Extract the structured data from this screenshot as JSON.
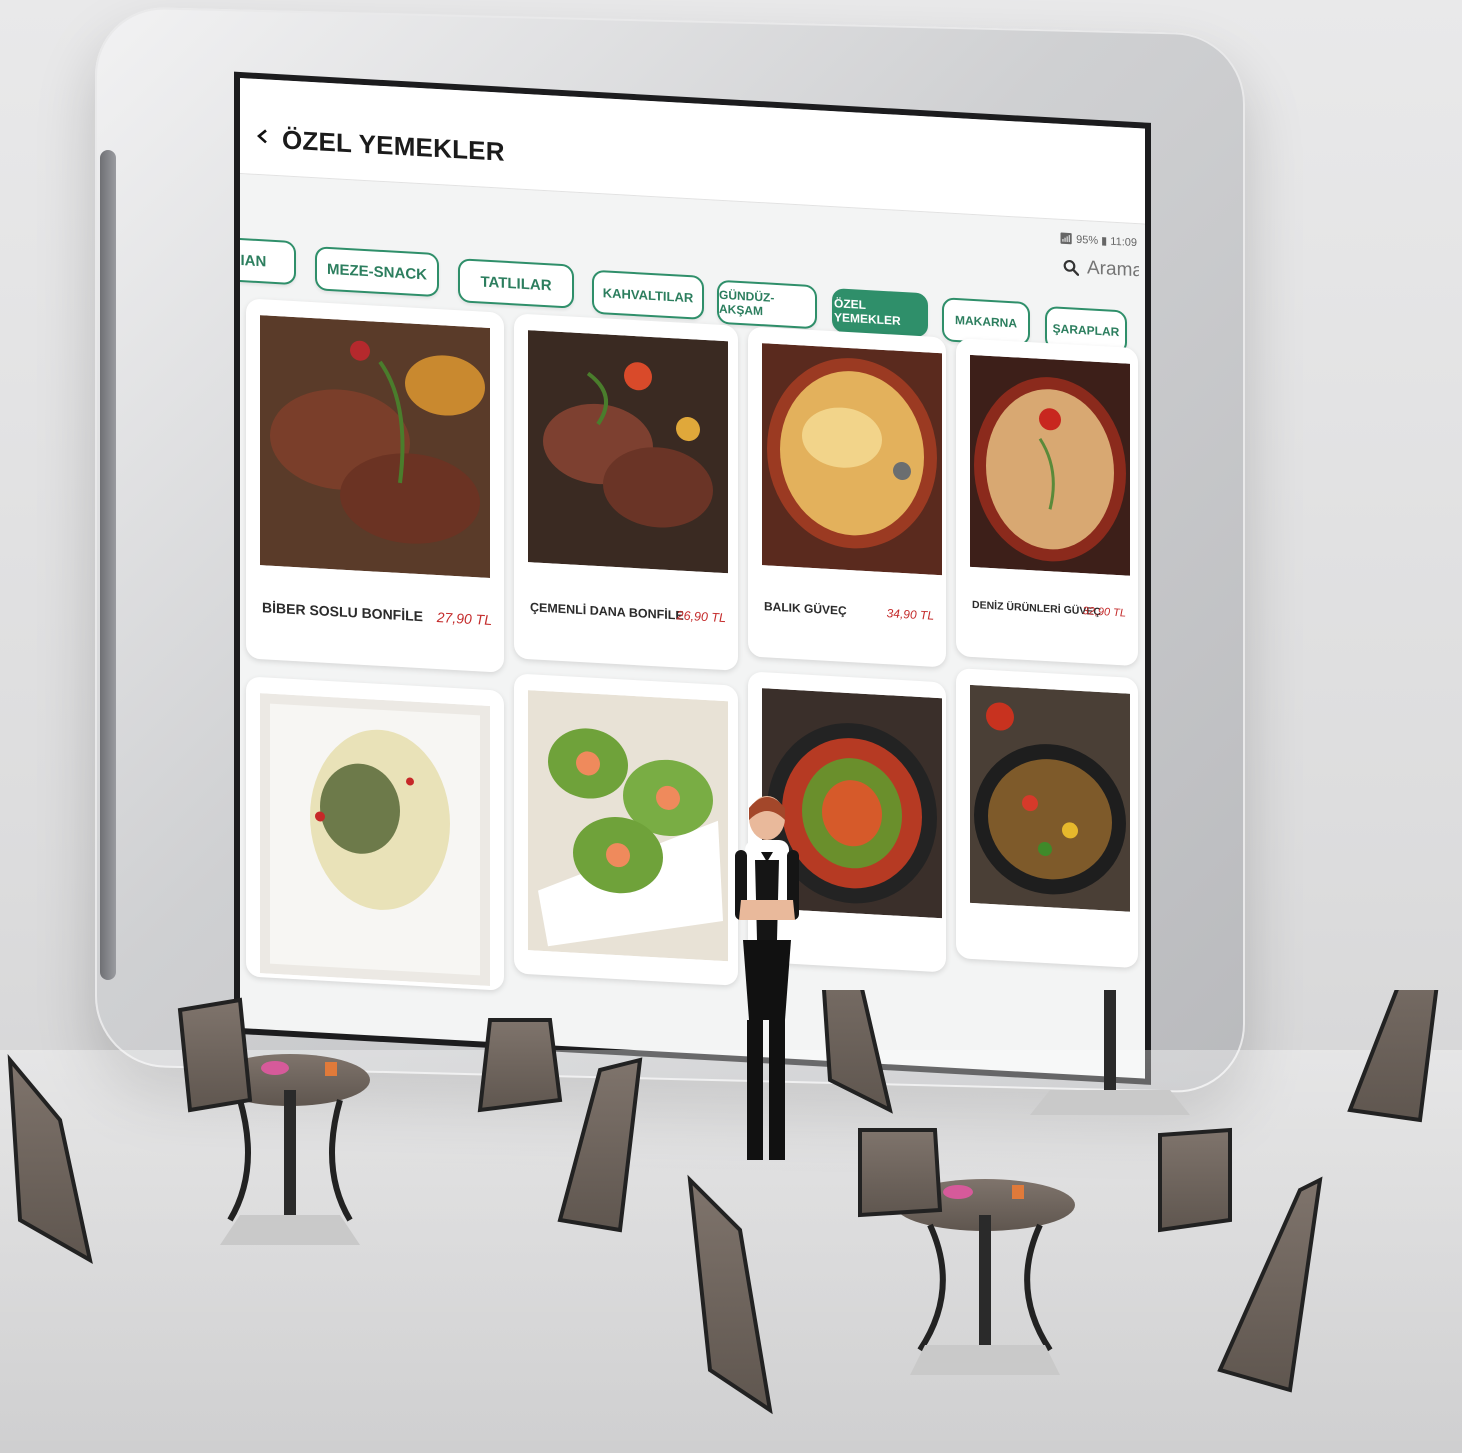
{
  "screen": {
    "title": "ÖZEL YEMEKLER",
    "status": "95% ▮ 11:09",
    "search_placeholder": "Arama"
  },
  "tabs": [
    {
      "label": "RIAN",
      "active": false
    },
    {
      "label": "MEZE-SNACK",
      "active": false
    },
    {
      "label": "TATLILAR",
      "active": false
    },
    {
      "label": "KAHVALTILAR",
      "active": false
    },
    {
      "label": "GÜNDÜZ-AKŞAM",
      "active": false
    },
    {
      "label": "ÖZEL YEMEKLER",
      "active": true
    },
    {
      "label": "MAKARNA",
      "active": false
    },
    {
      "label": "ŞARAPLAR",
      "active": false
    }
  ],
  "dishes": [
    {
      "name": "BİBER SOSLU BONFİLE",
      "price": "27,90 TL",
      "image": "steak-with-rosemary"
    },
    {
      "name": "ÇEMENLİ DANA BONFİLE",
      "price": "26,90 TL",
      "image": "beef-fillet-with-tomatoes"
    },
    {
      "name": "BALIK GÜVEÇ",
      "price": "34,90 TL",
      "image": "fish-casserole"
    },
    {
      "name": "DENİZ ÜRÜNLERİ GÜVEÇ",
      "price": "32,90 TL",
      "image": "seafood-casserole"
    },
    {
      "name": "",
      "price": "",
      "image": "fish-fillet-with-cream-sauce"
    },
    {
      "name": "",
      "price": "",
      "image": "shrimp-lettuce-cups"
    },
    {
      "name": "",
      "price": "",
      "image": "ratatouille-pan"
    },
    {
      "name": "",
      "price": "",
      "image": "chicken-pepper-stirfry"
    }
  ],
  "colors": {
    "accent": "#2f8f6a",
    "price": "#c42b2b",
    "screen_bg": "#f3f4f4"
  }
}
